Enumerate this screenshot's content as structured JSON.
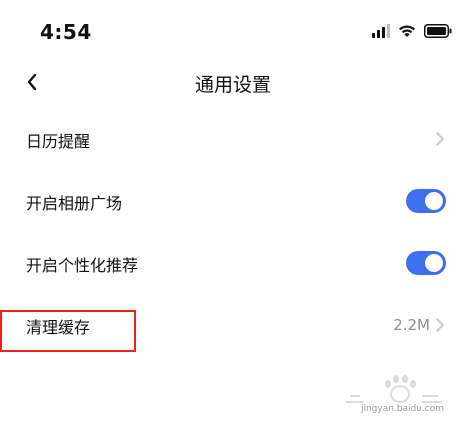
{
  "status_bar": {
    "time": "4:54"
  },
  "nav": {
    "title": "通用设置"
  },
  "settings": [
    {
      "label": "日历提醒",
      "type": "link"
    },
    {
      "label": "开启相册广场",
      "type": "toggle",
      "on": true
    },
    {
      "label": "开启个性化推荐",
      "type": "toggle",
      "on": true
    },
    {
      "label": "清理缓存",
      "type": "link",
      "value": "2.2M"
    }
  ],
  "colors": {
    "accent": "#3e6ff1",
    "highlight": "#e8241a"
  },
  "watermark": {
    "text": "jingyan.baidu.com"
  }
}
